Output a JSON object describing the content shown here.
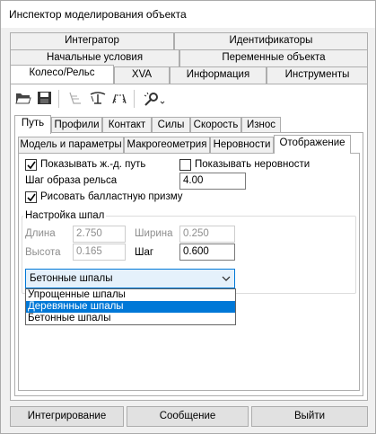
{
  "window": {
    "title": "Инспектор моделирования объекта"
  },
  "tabs_row1": [
    "Интегратор",
    "Идентификаторы"
  ],
  "tabs_row2": [
    "Начальные условия",
    "Переменные объекта"
  ],
  "tabs_row3": [
    "Колесо/Рельс",
    "XVA",
    "Информация",
    "Инструменты"
  ],
  "toolbar": {
    "icons": [
      "open-folder-icon",
      "save-icon",
      "wheel-profile-icon",
      "rail-profile-icon",
      "gauge-icon",
      "settings-wand-icon"
    ]
  },
  "subtabs": [
    "Путь",
    "Профили",
    "Контакт",
    "Силы",
    "Скорость",
    "Износ"
  ],
  "subsubtabs": [
    "Модель и параметры",
    "Макрогеометрия",
    "Неровности",
    "Отображение"
  ],
  "display": {
    "show_track_label": "Показывать ж.-д. путь",
    "show_track_checked": true,
    "show_irregularities_label": "Показывать неровности",
    "show_irregularities_checked": false,
    "rail_step_label": "Шаг образа рельса",
    "rail_step_value": "4.00",
    "draw_ballast_label": "Рисовать балластную призму",
    "draw_ballast_checked": true
  },
  "sleepers": {
    "group_title": "Настройка шпал",
    "length_label": "Длина",
    "length_value": "2.750",
    "width_label": "Ширина",
    "width_value": "0.250",
    "height_label": "Высота",
    "height_value": "0.165",
    "step_label": "Шаг",
    "step_value": "0.600",
    "type_selected": "Бетонные шпалы",
    "type_options": [
      "Упрощенные шпалы",
      "Деревянные шпалы",
      "Бетонные шпалы"
    ],
    "type_highlighted": "Деревянные шпалы"
  },
  "buttons": {
    "integrate": "Интегрирование",
    "message": "Сообщение",
    "exit": "Выйти"
  },
  "colors": {
    "accent": "#0078d7",
    "panel": "#ffffff",
    "window": "#f0f0f0"
  }
}
